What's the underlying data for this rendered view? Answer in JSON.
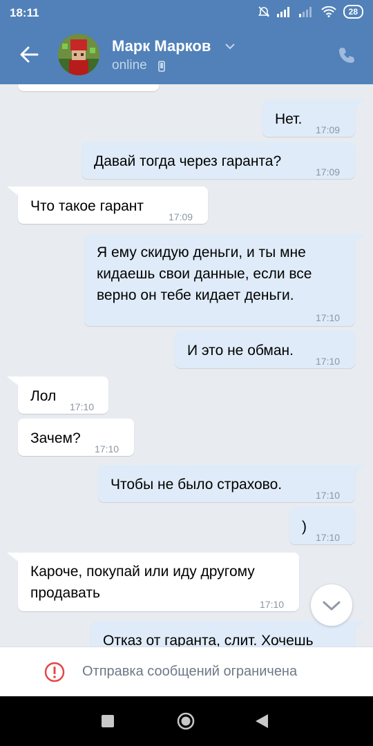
{
  "status_bar": {
    "time": "18:11",
    "battery": "28"
  },
  "header": {
    "contact_name": "Марк Марков",
    "contact_status": "online"
  },
  "messages": [
    {
      "dir": "out",
      "text": "Нет.",
      "time": "17:09"
    },
    {
      "dir": "out",
      "text": "Давай тогда через гаранта?",
      "time": "17:09"
    },
    {
      "dir": "in",
      "text": "Что такое гарант",
      "time": "17:09"
    },
    {
      "dir": "out",
      "lines": [
        "Я ему скидую деньги, и ты мне",
        "кидаешь свои данные, если все",
        "верно он тебе кидает деньги."
      ],
      "time": "17:10"
    },
    {
      "dir": "out",
      "text": "И это не обман.",
      "time": "17:10"
    },
    {
      "dir": "in",
      "text": "Лол",
      "time": "17:10"
    },
    {
      "dir": "in",
      "text": "Зачем?",
      "time": "17:10"
    },
    {
      "dir": "out",
      "text": "Чтобы не было страхово.",
      "time": "17:10"
    },
    {
      "dir": "out",
      "text": ")",
      "time": "17:10"
    },
    {
      "dir": "in",
      "lines": [
        "Кароче, покупай или иду другому",
        "продавать"
      ],
      "time": "17:10"
    },
    {
      "dir": "out",
      "text": "Отказ от гаранта, слит. Хочешь"
    }
  ],
  "footer": {
    "restriction_text": "Отправка сообщений ограничена"
  },
  "colors": {
    "header_bg": "#5181b8",
    "outgoing_bubble": "#dfebf8",
    "incoming_bubble": "#ffffff",
    "chat_bg": "#e8ecf1",
    "warning_red": "#e64646"
  }
}
